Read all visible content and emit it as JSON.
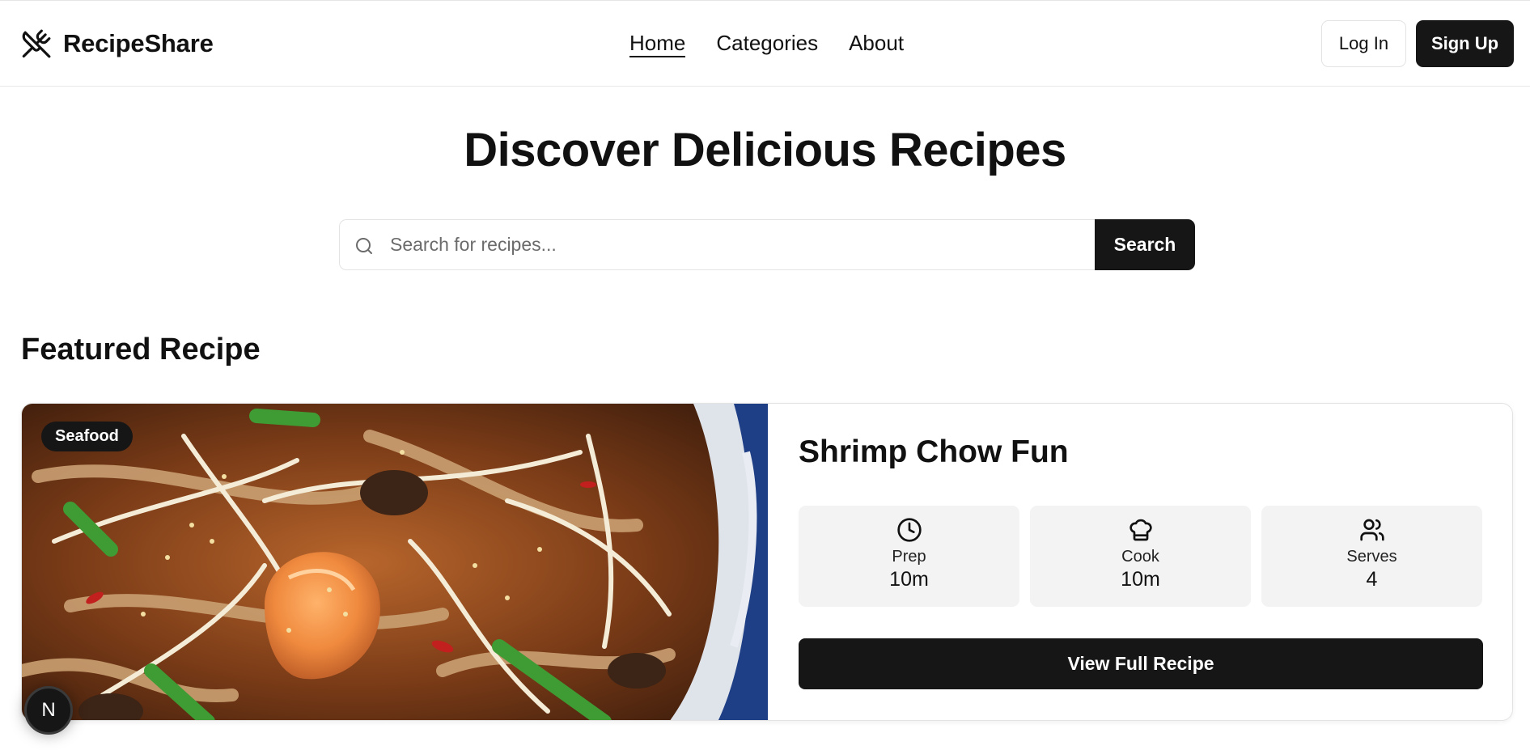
{
  "header": {
    "brand_name": "RecipeShare",
    "brand_icon": "utensils-crossed-icon",
    "nav": [
      {
        "label": "Home",
        "active": true
      },
      {
        "label": "Categories",
        "active": false
      },
      {
        "label": "About",
        "active": false
      }
    ],
    "login_label": "Log In",
    "signup_label": "Sign Up"
  },
  "hero": {
    "title": "Discover Delicious Recipes",
    "search_placeholder": "Search for recipes...",
    "search_value": "",
    "search_button": "Search"
  },
  "featured": {
    "section_title": "Featured Recipe",
    "category": "Seafood",
    "recipe_title": "Shrimp Chow Fun",
    "stats": [
      {
        "icon": "clock-icon",
        "label": "Prep",
        "value": "10m"
      },
      {
        "icon": "chef-hat-icon",
        "label": "Cook",
        "value": "10m"
      },
      {
        "icon": "users-icon",
        "label": "Serves",
        "value": "4"
      }
    ],
    "view_button": "View Full Recipe"
  },
  "dev_badge": {
    "letter": "N"
  },
  "colors": {
    "primary": "#161616",
    "stat_bg": "#f3f3f3",
    "border": "#e3e3e3"
  }
}
